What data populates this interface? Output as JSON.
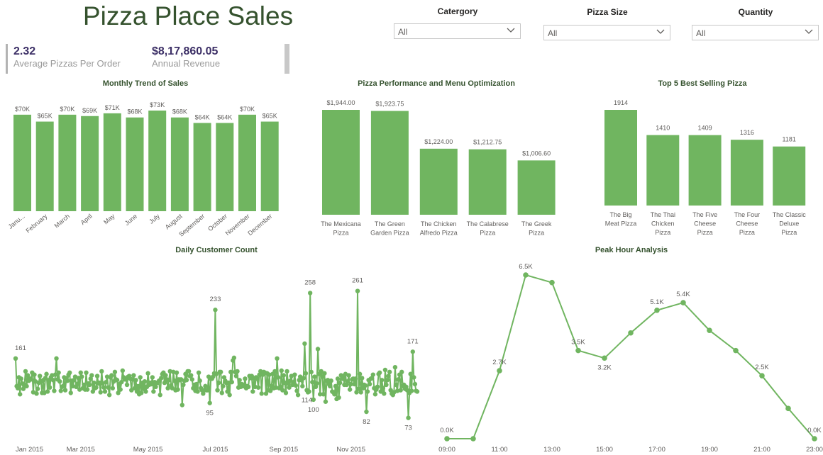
{
  "page": {
    "title": "Pizza Place Sales"
  },
  "filters": [
    {
      "label": "Catergory",
      "value": "All"
    },
    {
      "label": "Pizza Size",
      "value": "All"
    },
    {
      "label": "Quantity",
      "value": "All"
    }
  ],
  "kpis": [
    {
      "value": "2.32",
      "label": "Average Pizzas Per Order"
    },
    {
      "value": "$8,17,860.05",
      "label": "Annual Revenue"
    }
  ],
  "colors": {
    "bar": "#70b560",
    "line": "#70b560",
    "title": "#35522e",
    "kpi_value": "#3c2f66"
  },
  "chart_data": [
    {
      "type": "bar",
      "title": "Monthly Trend of Sales",
      "categories": [
        "Janu...",
        "February",
        "March",
        "April",
        "May",
        "June",
        "July",
        "August",
        "September",
        "October",
        "November",
        "December"
      ],
      "values": [
        70,
        65,
        70,
        69,
        71,
        68,
        73,
        68,
        64,
        64,
        70,
        65
      ],
      "data_labels": [
        "$70K",
        "$65K",
        "$70K",
        "$69K",
        "$71K",
        "$68K",
        "$73K",
        "$68K",
        "$64K",
        "$64K",
        "$70K",
        "$65K"
      ],
      "ylim": [
        0,
        73
      ]
    },
    {
      "type": "bar",
      "title": "Pizza Performance and Menu Optimization",
      "categories": [
        "The Mexicana Pizza",
        "The Green Garden Pizza",
        "The Chicken Alfredo Pizza",
        "The Calabrese Pizza",
        "The Greek Pizza"
      ],
      "category_lines": [
        [
          "The Mexicana",
          "Pizza"
        ],
        [
          "The Green",
          "Garden Pizza"
        ],
        [
          "The Chicken",
          "Alfredo Pizza"
        ],
        [
          "The Calabrese",
          "Pizza"
        ],
        [
          "The Greek",
          "Pizza"
        ]
      ],
      "values": [
        1944.0,
        1923.75,
        1224.0,
        1212.75,
        1006.6
      ],
      "data_labels": [
        "$1,944.00",
        "$1,923.75",
        "$1,224.00",
        "$1,212.75",
        "$1,006.60"
      ],
      "ylim": [
        0,
        1944
      ]
    },
    {
      "type": "bar",
      "title": "Top 5 Best Selling Pizza",
      "categories": [
        "The Big Meat Pizza",
        "The Thai Chicken Pizza",
        "The Five Cheese Pizza",
        "The Four Cheese Pizza",
        "The Classic Deluxe Pizza"
      ],
      "category_lines": [
        [
          "The Big",
          "Meat Pizza"
        ],
        [
          "The Thai",
          "Chicken",
          "Pizza"
        ],
        [
          "The Five",
          "Cheese",
          "Pizza"
        ],
        [
          "The Four",
          "Cheese",
          "Pizza"
        ],
        [
          "The Classic",
          "Deluxe",
          "Pizza"
        ]
      ],
      "values": [
        1914,
        1410,
        1409,
        1316,
        1181
      ],
      "data_labels": [
        "1914",
        "1410",
        "1409",
        "1316",
        "1181"
      ],
      "ylim": [
        0,
        1914
      ]
    },
    {
      "type": "line",
      "title": "Daily Customer Count",
      "x_tick_labels": [
        "Jan 2015",
        "Mar 2015",
        "May 2015",
        "Jul 2015",
        "Sep 2015",
        "Nov 2015"
      ],
      "x_tick_days": [
        0,
        59,
        120,
        181,
        243,
        304
      ],
      "days_in_year": 365,
      "ylim": [
        60,
        270
      ],
      "annotations": [
        {
          "day": 0,
          "value": 161,
          "label": "161"
        },
        {
          "day": 181,
          "value": 233,
          "label": "233"
        },
        {
          "day": 176,
          "value": 95,
          "label": "95"
        },
        {
          "day": 267,
          "value": 258,
          "label": "258"
        },
        {
          "day": 264,
          "value": 114,
          "label": "114"
        },
        {
          "day": 270,
          "value": 100,
          "label": "100"
        },
        {
          "day": 310,
          "value": 261,
          "label": "261"
        },
        {
          "day": 318,
          "value": 82,
          "label": "82"
        },
        {
          "day": 356,
          "value": 73,
          "label": "73"
        },
        {
          "day": 360,
          "value": 171,
          "label": "171"
        }
      ]
    },
    {
      "type": "line",
      "title": "Peak Hour Analysis",
      "x": [
        9,
        10,
        11,
        12,
        13,
        14,
        15,
        16,
        17,
        18,
        19,
        20,
        21,
        22,
        23
      ],
      "values": [
        0.0,
        0.0,
        2.7,
        6.5,
        6.2,
        3.5,
        3.2,
        4.2,
        5.1,
        5.4,
        4.3,
        3.5,
        2.5,
        1.2,
        0.0
      ],
      "data_labels": [
        "0.0K",
        "",
        "2.7K",
        "6.5K",
        "",
        "3.5K",
        "3.2K",
        "",
        "5.1K",
        "5.4K",
        "",
        "",
        "2.5K",
        "",
        "0.0K"
      ],
      "x_tick_labels": [
        "09:00",
        "11:00",
        "13:00",
        "15:00",
        "17:00",
        "19:00",
        "21:00",
        "23:00"
      ],
      "x_tick_hours": [
        9,
        11,
        13,
        15,
        17,
        19,
        21,
        23
      ],
      "ylim": [
        0,
        6.5
      ]
    }
  ]
}
